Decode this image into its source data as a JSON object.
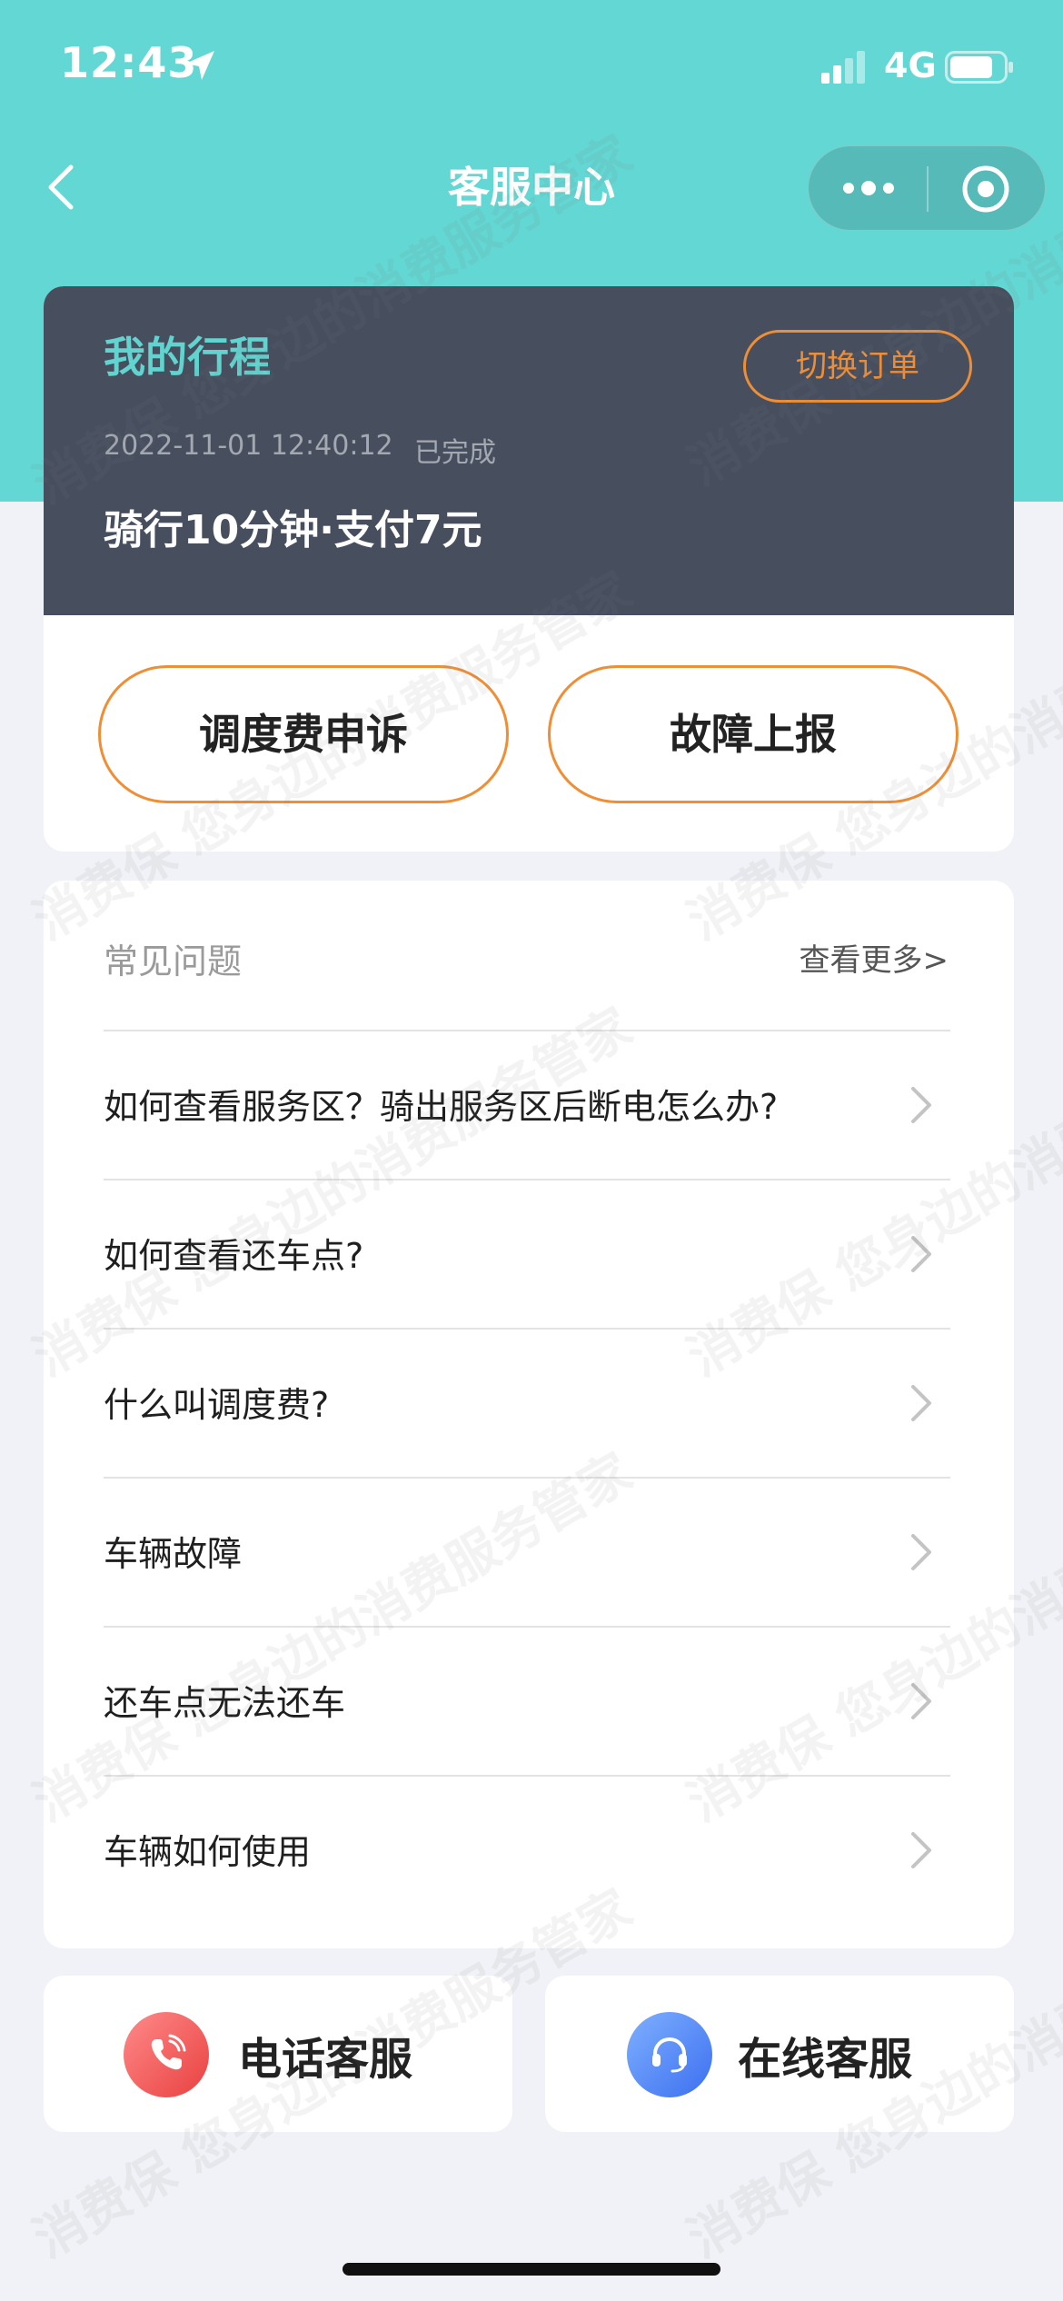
{
  "status_bar": {
    "time": "12:43",
    "network": "4G"
  },
  "nav": {
    "title": "客服中心"
  },
  "trip": {
    "title": "我的行程",
    "switch_label": "切换订单",
    "datetime": "2022-11-01 12:40:12",
    "status": "已完成",
    "summary": "骑行10分钟·支付7元"
  },
  "actions": {
    "appeal_label": "调度费申诉",
    "fault_label": "故障上报"
  },
  "faq": {
    "title": "常见问题",
    "more_label": "查看更多>",
    "items": [
      "如何查看服务区？骑出服务区后断电怎么办?",
      "如何查看还车点?",
      "什么叫调度费?",
      "车辆故障",
      "还车点无法还车",
      "车辆如何使用"
    ]
  },
  "services": {
    "phone_label": "电话客服",
    "online_label": "在线客服"
  },
  "watermark": {
    "text": "消费保 您身边的消费服务管家"
  },
  "colors": {
    "header_teal": "#63d7d3",
    "card_dark": "#474f5f",
    "accent_orange": "#f08e35",
    "trip_title_teal": "#61d4cf",
    "page_bg": "#f1f2f7"
  }
}
